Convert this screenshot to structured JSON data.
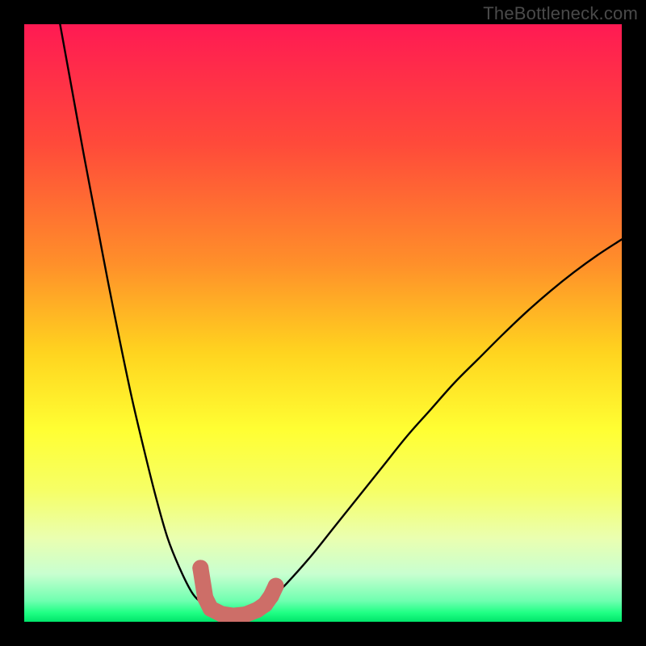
{
  "watermark": "TheBottleneck.com",
  "colors": {
    "frame": "#000000",
    "gradient_stops": [
      {
        "offset": 0.0,
        "color": "#ff1a53"
      },
      {
        "offset": 0.2,
        "color": "#ff4a3a"
      },
      {
        "offset": 0.4,
        "color": "#ff8f2a"
      },
      {
        "offset": 0.55,
        "color": "#ffd41f"
      },
      {
        "offset": 0.68,
        "color": "#ffff33"
      },
      {
        "offset": 0.78,
        "color": "#f6ff66"
      },
      {
        "offset": 0.86,
        "color": "#eaffb0"
      },
      {
        "offset": 0.92,
        "color": "#c8ffd0"
      },
      {
        "offset": 0.965,
        "color": "#6fffb0"
      },
      {
        "offset": 0.985,
        "color": "#1fff84"
      },
      {
        "offset": 1.0,
        "color": "#00e46a"
      }
    ],
    "curve": "#000000",
    "marker_fill": "#cd6e68",
    "marker_stroke": "#cd6e68"
  },
  "chart_data": {
    "type": "line",
    "title": "",
    "xlabel": "",
    "ylabel": "",
    "xlim": [
      0,
      100
    ],
    "ylim": [
      0,
      100
    ],
    "grid": false,
    "legend": false,
    "series": [
      {
        "name": "left-branch",
        "x": [
          6,
          8,
          10,
          12,
          14,
          16,
          18,
          20,
          22,
          24,
          26,
          28,
          29.5,
          31
        ],
        "y": [
          100,
          89,
          78,
          67.5,
          57,
          47,
          37.5,
          29,
          21,
          14,
          9,
          5,
          3.3,
          2.2
        ]
      },
      {
        "name": "valley-floor",
        "x": [
          31,
          33,
          35,
          37,
          39,
          41
        ],
        "y": [
          2.2,
          1.3,
          1.0,
          1.2,
          2.0,
          3.5
        ]
      },
      {
        "name": "right-branch",
        "x": [
          41,
          44,
          48,
          52,
          56,
          60,
          64,
          68,
          72,
          76,
          80,
          84,
          88,
          92,
          96,
          100
        ],
        "y": [
          3.5,
          6.5,
          11,
          16,
          21,
          26,
          31,
          35.5,
          40,
          44,
          48,
          51.8,
          55.3,
          58.5,
          61.4,
          64
        ]
      }
    ],
    "markers": {
      "name": "highlighted-points",
      "style": "thick-rounded-segments",
      "color": "#cd6e68",
      "points_xy": [
        [
          29.5,
          9.0
        ],
        [
          30.3,
          4.0
        ],
        [
          31.2,
          2.2
        ],
        [
          33.0,
          1.3
        ],
        [
          35.0,
          1.0
        ],
        [
          37.0,
          1.2
        ],
        [
          39.0,
          2.0
        ],
        [
          40.3,
          2.9
        ],
        [
          41.3,
          4.3
        ],
        [
          42.1,
          6.0
        ]
      ]
    }
  }
}
